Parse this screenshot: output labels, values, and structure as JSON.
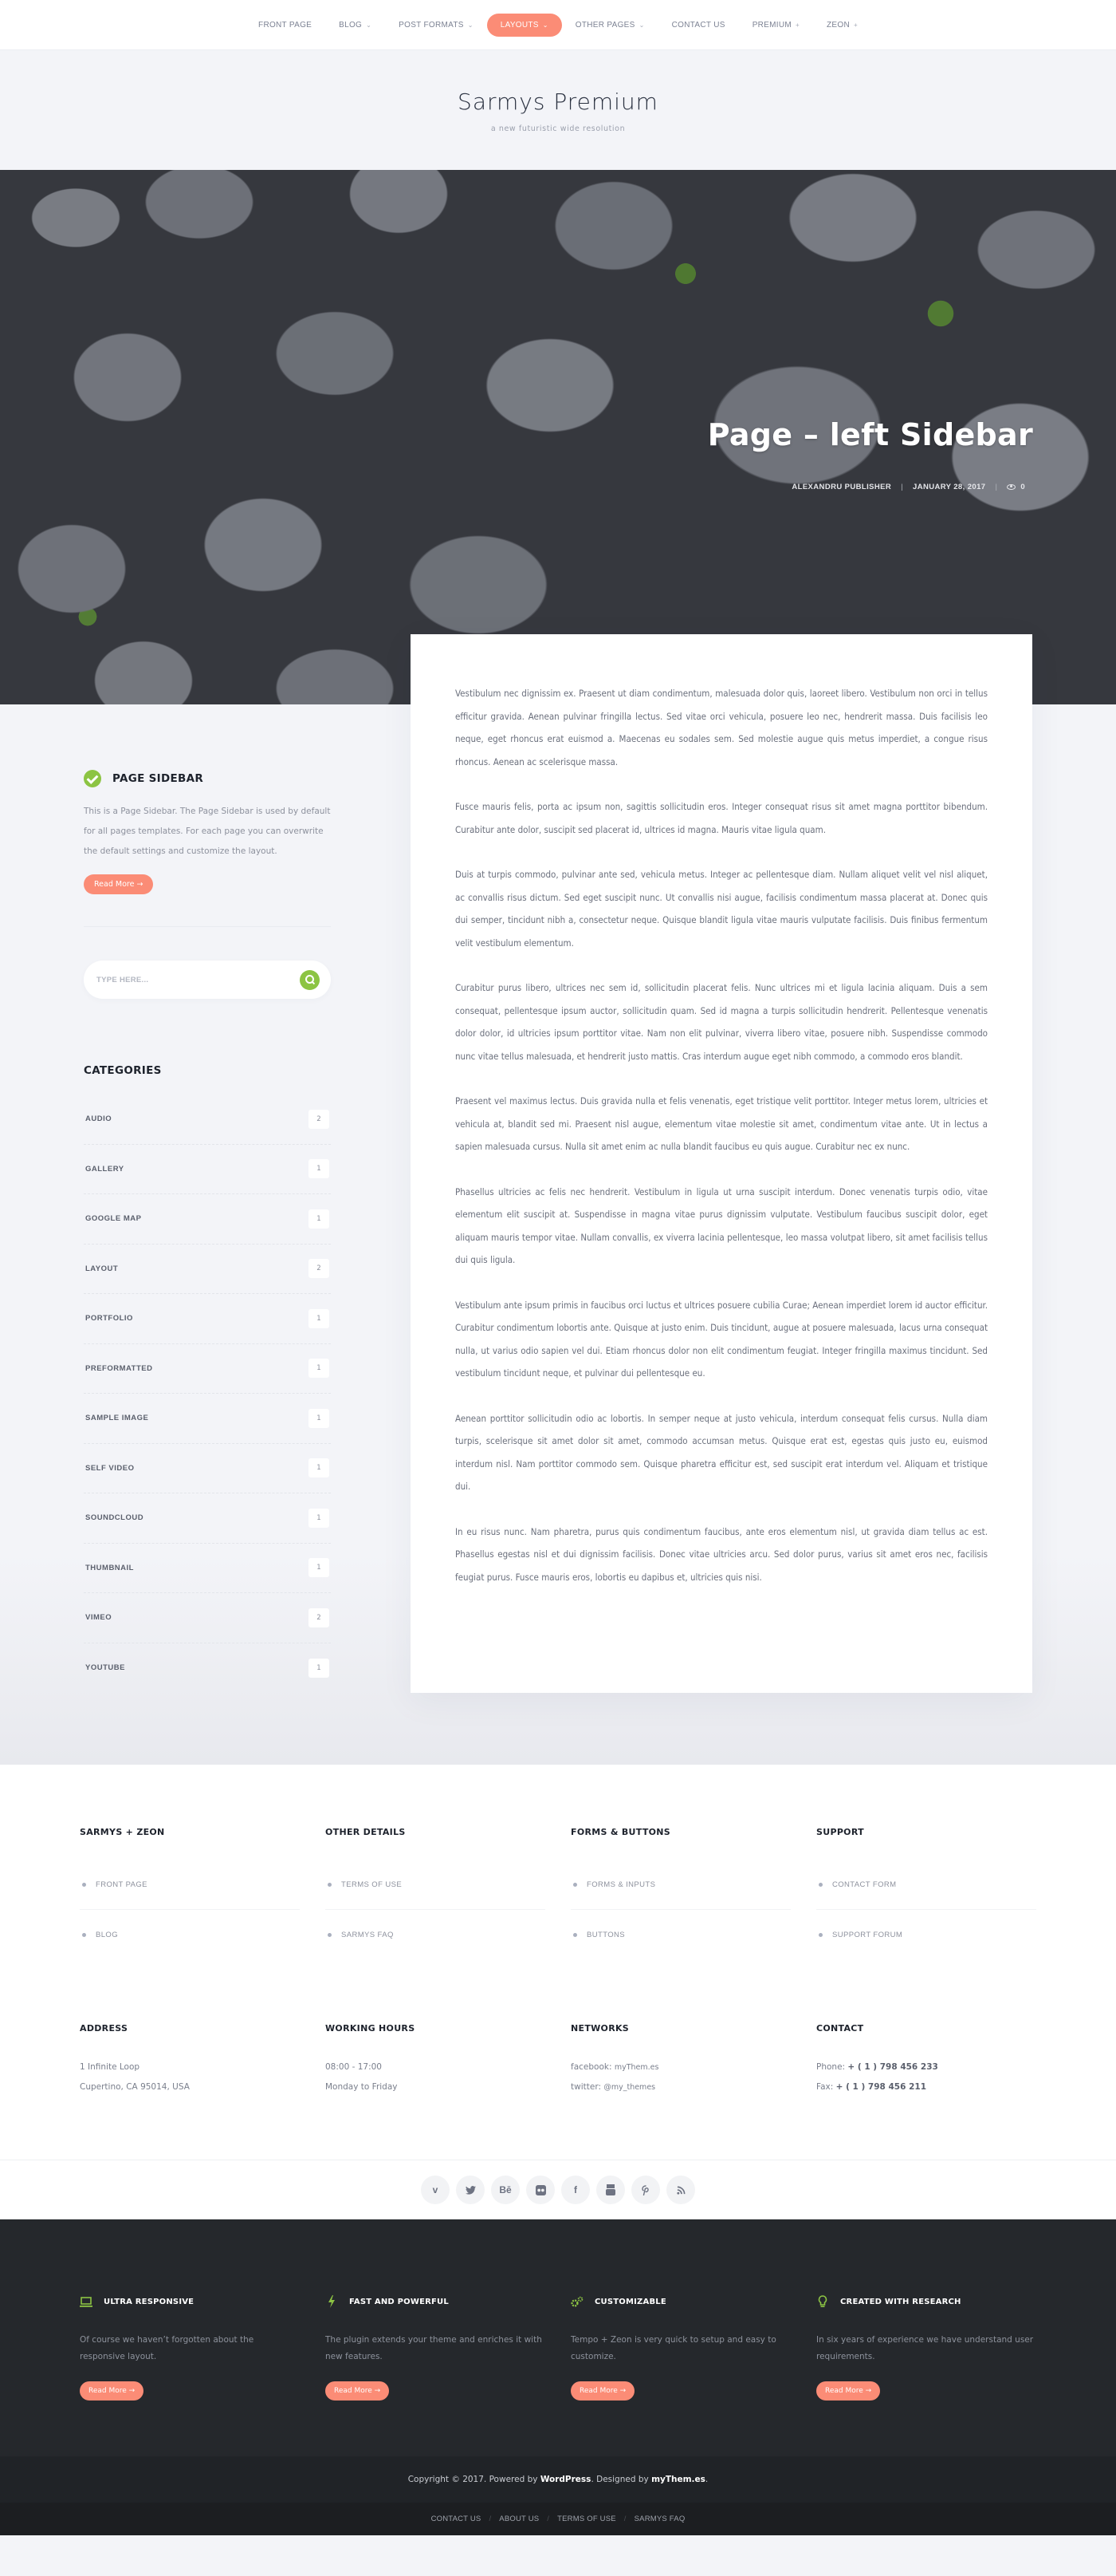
{
  "nav": {
    "items": [
      {
        "label": "FRONT PAGE",
        "caret": ""
      },
      {
        "label": "BLOG",
        "caret": "⌄"
      },
      {
        "label": "POST FORMATS",
        "caret": "⌄"
      },
      {
        "label": "LAYOUTS",
        "caret": "⌄",
        "active": true
      },
      {
        "label": "OTHER PAGES",
        "caret": "⌄"
      },
      {
        "label": "CONTACT US",
        "caret": ""
      },
      {
        "label": "PREMIUM",
        "caret": "+"
      },
      {
        "label": "ZEON",
        "caret": "+"
      }
    ]
  },
  "branding": {
    "title": "Sarmys Premium",
    "description": "a new futuristic wide resolution"
  },
  "hero": {
    "title": "Page – left Sidebar",
    "author": "ALEXANDRU PUBLISHER",
    "date": "JANUARY 28, 2017",
    "views": "0",
    "separator": "|"
  },
  "sidebar": {
    "widget": {
      "title": "PAGE SIDEBAR",
      "text": "This is a Page Sidebar. The Page Sidebar is used by default for all pages templates. For each page you can overwrite the default settings and customize the layout.",
      "button": "Read More →"
    },
    "search": {
      "placeholder": "TYPE HERE..."
    },
    "categories": {
      "title": "CATEGORIES",
      "items": [
        {
          "name": "AUDIO",
          "count": "2"
        },
        {
          "name": "GALLERY",
          "count": "1"
        },
        {
          "name": "GOOGLE MAP",
          "count": "1"
        },
        {
          "name": "LAYOUT",
          "count": "2"
        },
        {
          "name": "PORTFOLIO",
          "count": "1"
        },
        {
          "name": "PREFORMATTED",
          "count": "1"
        },
        {
          "name": "SAMPLE IMAGE",
          "count": "1"
        },
        {
          "name": "SELF VIDEO",
          "count": "1"
        },
        {
          "name": "SOUNDCLOUD",
          "count": "1"
        },
        {
          "name": "THUMBNAIL",
          "count": "1"
        },
        {
          "name": "VIMEO",
          "count": "2"
        },
        {
          "name": "YOUTUBE",
          "count": "1"
        }
      ]
    }
  },
  "content": {
    "paragraphs": [
      "Vestibulum nec dignissim ex. Praesent ut diam condimentum, malesuada dolor quis, laoreet libero. Vestibulum non orci in tellus efficitur gravida. Aenean pulvinar fringilla lectus. Sed vitae orci vehicula, posuere leo nec, hendrerit massa. Duis facilisis leo neque, eget rhoncus erat euismod a. Maecenas eu sodales sem. Sed molestie augue quis metus imperdiet, a congue risus rhoncus. Aenean ac scelerisque massa.",
      "Fusce mauris felis, porta ac ipsum non, sagittis sollicitudin eros. Integer consequat risus sit amet magna porttitor bibendum. Curabitur ante dolor, suscipit sed placerat id, ultrices id magna. Mauris vitae ligula quam.",
      "Duis at turpis commodo, pulvinar ante sed, vehicula metus. Integer ac pellentesque diam. Nullam aliquet velit vel nisl aliquet, ac convallis risus dictum. Sed eget suscipit nunc. Ut convallis nisi augue, facilisis condimentum massa placerat at. Donec quis dui semper, tincidunt nibh a, consectetur neque. Quisque blandit ligula vitae mauris vulputate facilisis. Duis finibus fermentum velit vestibulum elementum.",
      "Curabitur purus libero, ultrices nec sem id, sollicitudin placerat felis. Nunc ultrices mi et ligula lacinia aliquam. Duis a sem consequat, pellentesque ipsum auctor, sollicitudin quam. Sed id magna a turpis sollicitudin hendrerit. Pellentesque venenatis dolor dolor, id ultricies ipsum porttitor vitae. Nam non elit pulvinar, viverra libero vitae, posuere nibh. Suspendisse commodo nunc vitae tellus malesuada, et hendrerit justo mattis. Cras interdum augue eget nibh commodo, a commodo eros blandit.",
      "Praesent vel maximus lectus. Duis gravida nulla et felis venenatis, eget tristique velit porttitor. Integer metus lorem, ultricies et vehicula at, blandit sed mi. Praesent nisl augue, elementum vitae molestie sit amet, condimentum vitae ante. Ut in lectus a sapien malesuada cursus. Nulla sit amet enim ac nulla blandit faucibus eu quis augue. Curabitur nec ex nunc.",
      "Phasellus ultricies ac felis nec hendrerit. Vestibulum in ligula ut urna suscipit interdum. Donec venenatis turpis odio, vitae elementum elit suscipit at. Suspendisse in magna vitae purus dignissim vulputate. Vestibulum faucibus suscipit dolor, eget aliquam mauris tempor vitae. Nullam convallis, ex viverra lacinia pellentesque, leo massa volutpat libero, sit amet facilisis tellus dui quis ligula.",
      "Vestibulum ante ipsum primis in faucibus orci luctus et ultrices posuere cubilia Curae; Aenean imperdiet lorem id auctor efficitur. Curabitur condimentum lobortis ante. Quisque at justo enim. Duis tincidunt, augue at posuere malesuada, lacus urna consequat nulla, ut varius odio sapien vel dui. Etiam rhoncus dolor non elit condimentum feugiat. Integer fringilla maximus tincidunt. Sed vestibulum tincidunt neque, et pulvinar dui pellentesque eu.",
      "Aenean porttitor sollicitudin odio ac lobortis. In semper neque at justo vehicula, interdum consequat felis cursus. Nulla diam turpis, scelerisque sit amet dolor sit amet, commodo accumsan metus. Quisque erat est, egestas quis justo eu, euismod interdum nisl. Nam porttitor commodo sem. Quisque pharetra efficitur est, sed suscipit erat interdum vel. Aliquam et tristique dui.",
      "In eu risus nunc. Nam pharetra, purus quis condimentum faucibus, ante eros elementum nisl, ut gravida diam tellus ac est. Phasellus egestas nisl et dui dignissim facilisis. Donec vitae ultricies arcu. Sed dolor purus, varius sit amet eros nec, facilisis feugiat purus. Fusce mauris eros, lobortis eu dapibus et, ultricies quis nisi."
    ]
  },
  "footer_menus": [
    {
      "title": "SARMYS + ZEON",
      "links": [
        "FRONT PAGE",
        "BLOG"
      ]
    },
    {
      "title": "OTHER DETAILS",
      "links": [
        "TERMS OF USE",
        "SARMYS FAQ"
      ]
    },
    {
      "title": "FORMS & BUTTONS",
      "links": [
        "FORMS & INPUTS",
        "BUTTONS"
      ]
    },
    {
      "title": "SUPPORT",
      "links": [
        "CONTACT FORM",
        "SUPPORT FORUM"
      ]
    }
  ],
  "footer_info": {
    "address": {
      "title": "ADDRESS",
      "line1": "1 Infinite Loop",
      "line2": "Cupertino, CA 95014, USA"
    },
    "hours": {
      "title": "WORKING HOURS",
      "line1": "08:00 - 17:00",
      "line2": "Monday to Friday"
    },
    "networks": {
      "title": "NETWORKS",
      "facebook_label": "facebook:",
      "facebook_value": "myThem.es",
      "twitter_label": "twitter:",
      "twitter_value": "@my_themes"
    },
    "contact": {
      "title": "CONTACT",
      "phone_label": "Phone:",
      "phone_value": "+ ( 1 ) 798 456 233",
      "fax_label": "Fax:",
      "fax_value": "+ ( 1 ) 798 456 211"
    }
  },
  "social": [
    {
      "name": "vimeo",
      "glyph": "v"
    },
    {
      "name": "twitter",
      "glyph": "🐦"
    },
    {
      "name": "behance",
      "glyph": "Bē"
    },
    {
      "name": "flickr",
      "glyph": "••"
    },
    {
      "name": "facebook",
      "glyph": "f"
    },
    {
      "name": "youtube",
      "glyph": "▶"
    },
    {
      "name": "pinterest",
      "glyph": "P"
    },
    {
      "name": "rss",
      "glyph": "◝"
    }
  ],
  "features": [
    {
      "icon": "laptop",
      "glyph": "▭",
      "title": "ULTRA RESPONSIVE",
      "text": "Of course we haven’t forgotten about the responsive layout.",
      "button": "Read More →"
    },
    {
      "icon": "bolt",
      "glyph": "ϟ",
      "title": "FAST AND POWERFUL",
      "text": "The plugin extends your theme and enriches it with new features.",
      "button": "Read More →"
    },
    {
      "icon": "gears",
      "glyph": "⚙",
      "title": "CUSTOMIZABLE",
      "text": "Tempo + Zeon is very quick to setup and easy to customize.",
      "button": "Read More →"
    },
    {
      "icon": "lightbulb",
      "glyph": "♁",
      "title": "CREATED WITH RESEARCH",
      "text": "In six years of experience we have understand user requirements.",
      "button": "Read More →"
    }
  ],
  "copyright": {
    "prefix": "Copyright © 2017. Powered by ",
    "wp": "WordPress",
    "middle": ". Designed by ",
    "designer": "myThem.es",
    "suffix": "."
  },
  "bottom_links": [
    "CONTACT US",
    "ABOUT US",
    "TERMS OF USE",
    "SARMYS FAQ"
  ],
  "colors": {
    "accent": "#fb8c76",
    "green": "#8cc443",
    "dark_bg": "#25282c",
    "page_bg": "#f3f4f8"
  }
}
